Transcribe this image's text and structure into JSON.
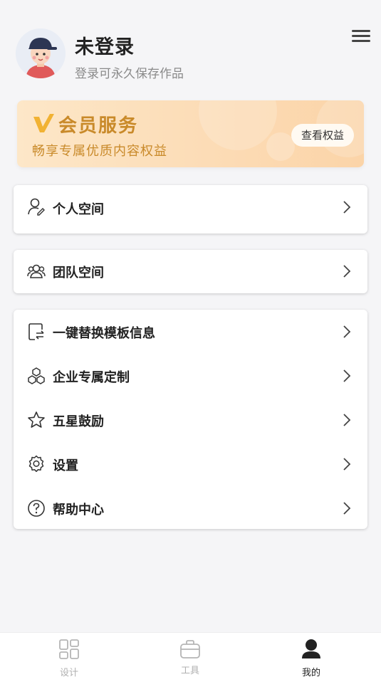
{
  "profile": {
    "name": "未登录",
    "subtitle": "登录可永久保存作品"
  },
  "vip": {
    "title": "会员服务",
    "subtitle": "畅享专属优质内容权益",
    "button_label": "查看权益",
    "text_color": "#c98a2a"
  },
  "menu_cards": [
    {
      "items": [
        {
          "label": "个人空间",
          "icon": "personal-space-icon"
        }
      ]
    },
    {
      "items": [
        {
          "label": "团队空间",
          "icon": "team-icon"
        }
      ]
    },
    {
      "items": [
        {
          "label": "一键替换模板信息",
          "icon": "replace-template-icon"
        },
        {
          "label": "企业专属定制",
          "icon": "hexagons-icon"
        },
        {
          "label": "五星鼓励",
          "icon": "star-icon"
        },
        {
          "label": "设置",
          "icon": "gear-icon"
        },
        {
          "label": "帮助中心",
          "icon": "help-icon"
        }
      ]
    }
  ],
  "tabbar": {
    "tabs": [
      {
        "label": "设计",
        "icon": "grid-icon",
        "active": false
      },
      {
        "label": "工具",
        "icon": "toolbox-icon",
        "active": false
      },
      {
        "label": "我的",
        "icon": "user-icon",
        "active": true
      }
    ]
  }
}
